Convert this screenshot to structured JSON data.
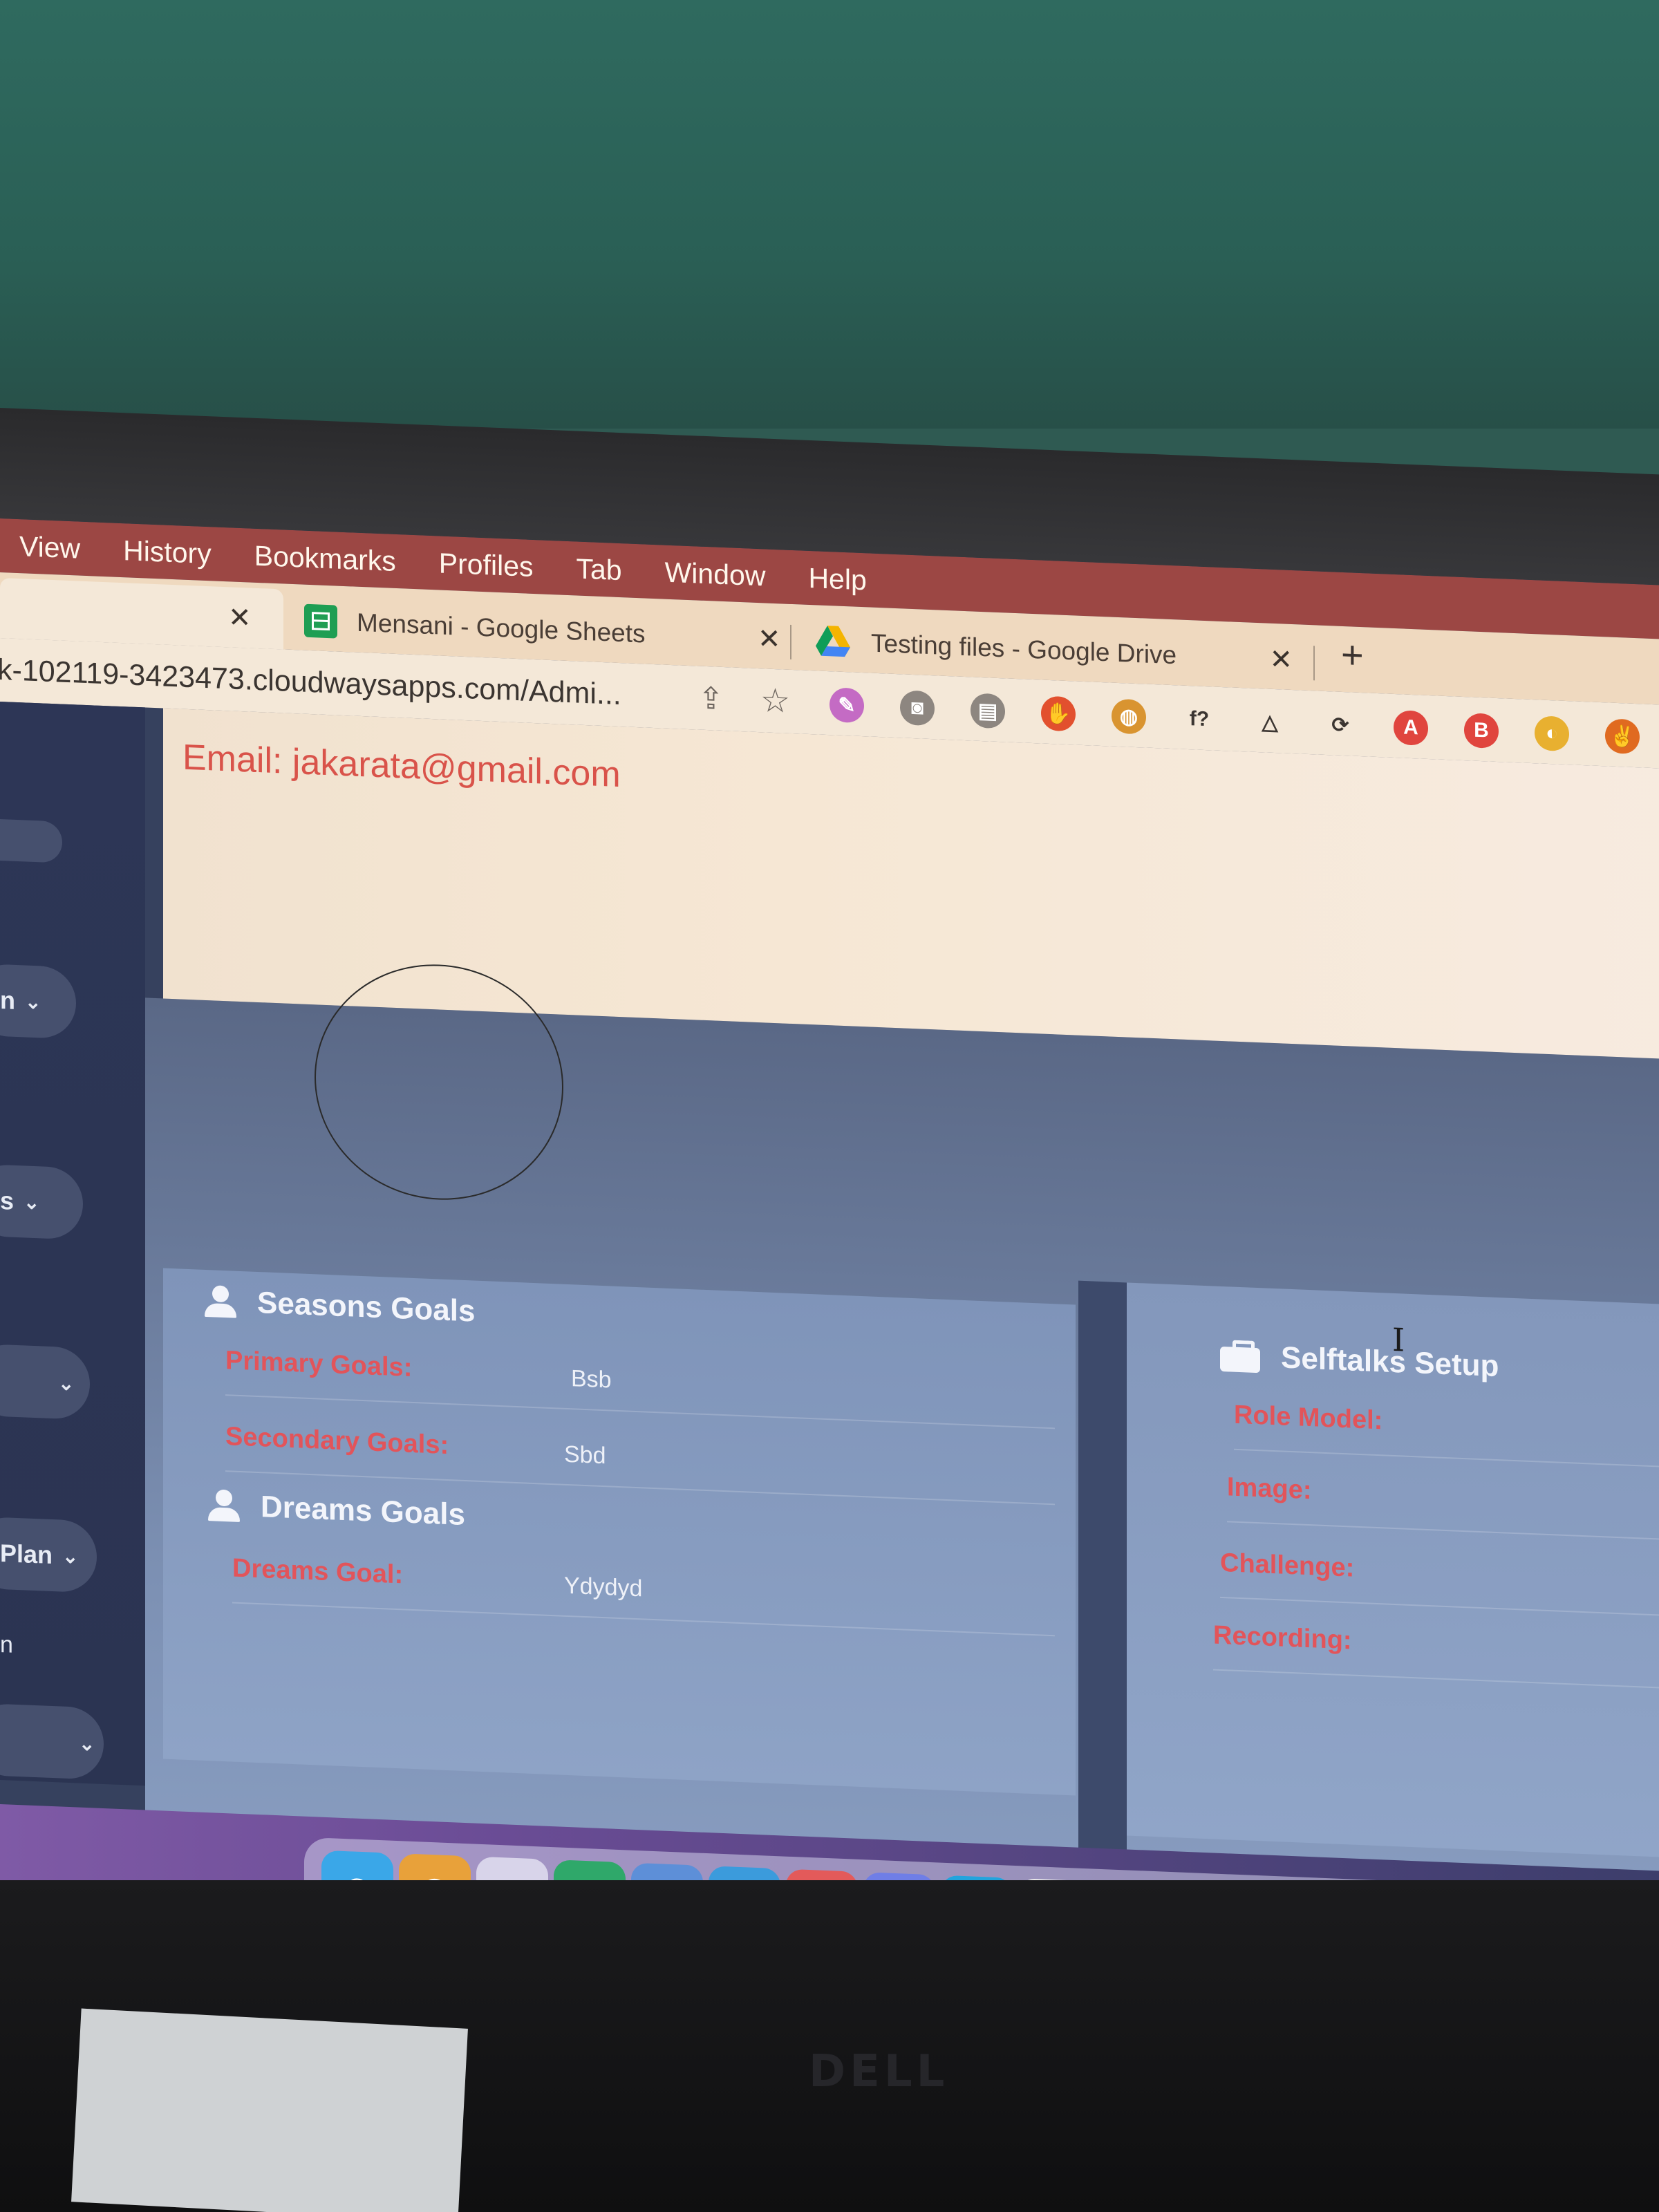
{
  "menubar": {
    "items": [
      "View",
      "History",
      "Bookmarks",
      "Profiles",
      "Tab",
      "Window",
      "Help"
    ]
  },
  "tabs": [
    {
      "title": "",
      "close": "✕"
    },
    {
      "title": "Mensani - Google Sheets",
      "close": "✕"
    },
    {
      "title": "Testing files - Google Drive",
      "close": "✕"
    }
  ],
  "new_tab": "+",
  "address_bar": {
    "url": "k-102119-3423473.cloudwaysapps.com/Admi..."
  },
  "extensions": [
    {
      "name": "pen-icon",
      "glyph": "✎",
      "color": "#c46bc4"
    },
    {
      "name": "camera-icon",
      "glyph": "◙",
      "color": "#8d8680"
    },
    {
      "name": "clipboard-icon",
      "glyph": "▤",
      "color": "#8d8680"
    },
    {
      "name": "hand-stop-icon",
      "glyph": "✋",
      "color": "#e2502e"
    },
    {
      "name": "basket-icon",
      "glyph": "◍",
      "color": "#d99430"
    },
    {
      "name": "formula-icon",
      "glyph": "f?",
      "color": "#f4e8d8"
    },
    {
      "name": "triangle-icon",
      "glyph": "△",
      "color": "#f4e8d8"
    },
    {
      "name": "sync-icon",
      "glyph": "⟳",
      "color": "#f4e8d8"
    },
    {
      "name": "font-a-icon",
      "glyph": "A",
      "color": "#e0453e"
    },
    {
      "name": "badge-b-icon",
      "glyph": "B",
      "color": "#e0453e"
    },
    {
      "name": "mouse-icon",
      "glyph": "◐",
      "color": "#e8b030"
    },
    {
      "name": "peace-icon",
      "glyph": "✌",
      "color": "#e06a20"
    }
  ],
  "profile": {
    "email_line": "Email: jakarata@gmail.com"
  },
  "sidebar": {
    "items": [
      {
        "label": "n",
        "chevron": "⌄"
      },
      {
        "label": "s",
        "chevron": "⌄"
      },
      {
        "label": "",
        "chevron": "⌄"
      },
      {
        "label": "Plan",
        "chevron": "⌄"
      },
      {
        "label": "n",
        "chevron": ""
      },
      {
        "label": "",
        "chevron": "⌄"
      }
    ]
  },
  "seasons_goals": {
    "title": "Seasons Goals",
    "rows": [
      {
        "label": "Primary Goals:",
        "value": "Bsb"
      },
      {
        "label": "Secondary Goals:",
        "value": "Sbd"
      }
    ]
  },
  "dreams_goals": {
    "title": "Dreams Goals",
    "rows": [
      {
        "label": "Dreams Goal:",
        "value": "Ydydyd"
      }
    ]
  },
  "selftalks_setup": {
    "title": "Selftalks Setup",
    "rows": [
      {
        "label": "Role Model:",
        "value": ""
      },
      {
        "label": "Image:",
        "value": ""
      },
      {
        "label": "Challenge:",
        "value": ""
      },
      {
        "label": "Recording:",
        "value": ""
      }
    ]
  },
  "dock": {
    "apps": [
      {
        "name": "finder-icon",
        "color": "#3aa7e8",
        "glyph": "☺"
      },
      {
        "name": "chrome-icon",
        "color": "#e8a13a",
        "glyph": "◉"
      },
      {
        "name": "launchpad-icon",
        "color": "#d8d4ea",
        "glyph": "⁙"
      },
      {
        "name": "numbers-icon",
        "color": "#2fa86a",
        "glyph": "▦"
      },
      {
        "name": "dropzone-icon",
        "color": "#5d8fd8",
        "glyph": "◌"
      },
      {
        "name": "safari-icon",
        "color": "#3b9bdc",
        "glyph": "⊘"
      },
      {
        "name": "anydesk-icon",
        "color": "#e35a5a",
        "glyph": "◆"
      },
      {
        "name": "discord-icon",
        "color": "#6f7ee6",
        "glyph": "☻"
      },
      {
        "name": "skype-icon",
        "color": "#22a4dd",
        "glyph": "S"
      },
      {
        "name": "calendar-icon",
        "color": "#eeeeee",
        "glyph": "25"
      },
      {
        "name": "bolt-icon",
        "color": "#2f8fc0",
        "glyph": "⚡"
      },
      {
        "name": "firefox-icon",
        "color": "#e4702f",
        "glyph": "◕"
      },
      {
        "name": "edge-icon",
        "color": "#bcdcf2",
        "glyph": "◠"
      },
      {
        "name": "notes-icon",
        "color": "#f3e08a",
        "glyph": "▭"
      },
      {
        "name": "trash-icon",
        "color": "#dcdde8",
        "glyph": "▯"
      }
    ]
  }
}
